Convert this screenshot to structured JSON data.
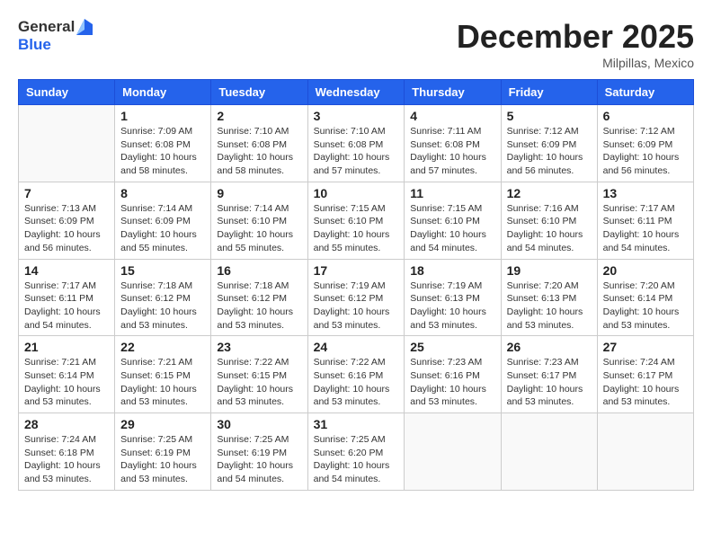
{
  "header": {
    "logo_line1": "General",
    "logo_line2": "Blue",
    "month": "December 2025",
    "location": "Milpillas, Mexico"
  },
  "weekdays": [
    "Sunday",
    "Monday",
    "Tuesday",
    "Wednesday",
    "Thursday",
    "Friday",
    "Saturday"
  ],
  "weeks": [
    [
      {
        "day": "",
        "info": ""
      },
      {
        "day": "1",
        "info": "Sunrise: 7:09 AM\nSunset: 6:08 PM\nDaylight: 10 hours\nand 58 minutes."
      },
      {
        "day": "2",
        "info": "Sunrise: 7:10 AM\nSunset: 6:08 PM\nDaylight: 10 hours\nand 58 minutes."
      },
      {
        "day": "3",
        "info": "Sunrise: 7:10 AM\nSunset: 6:08 PM\nDaylight: 10 hours\nand 57 minutes."
      },
      {
        "day": "4",
        "info": "Sunrise: 7:11 AM\nSunset: 6:08 PM\nDaylight: 10 hours\nand 57 minutes."
      },
      {
        "day": "5",
        "info": "Sunrise: 7:12 AM\nSunset: 6:09 PM\nDaylight: 10 hours\nand 56 minutes."
      },
      {
        "day": "6",
        "info": "Sunrise: 7:12 AM\nSunset: 6:09 PM\nDaylight: 10 hours\nand 56 minutes."
      }
    ],
    [
      {
        "day": "7",
        "info": "Sunrise: 7:13 AM\nSunset: 6:09 PM\nDaylight: 10 hours\nand 56 minutes."
      },
      {
        "day": "8",
        "info": "Sunrise: 7:14 AM\nSunset: 6:09 PM\nDaylight: 10 hours\nand 55 minutes."
      },
      {
        "day": "9",
        "info": "Sunrise: 7:14 AM\nSunset: 6:10 PM\nDaylight: 10 hours\nand 55 minutes."
      },
      {
        "day": "10",
        "info": "Sunrise: 7:15 AM\nSunset: 6:10 PM\nDaylight: 10 hours\nand 55 minutes."
      },
      {
        "day": "11",
        "info": "Sunrise: 7:15 AM\nSunset: 6:10 PM\nDaylight: 10 hours\nand 54 minutes."
      },
      {
        "day": "12",
        "info": "Sunrise: 7:16 AM\nSunset: 6:10 PM\nDaylight: 10 hours\nand 54 minutes."
      },
      {
        "day": "13",
        "info": "Sunrise: 7:17 AM\nSunset: 6:11 PM\nDaylight: 10 hours\nand 54 minutes."
      }
    ],
    [
      {
        "day": "14",
        "info": "Sunrise: 7:17 AM\nSunset: 6:11 PM\nDaylight: 10 hours\nand 54 minutes."
      },
      {
        "day": "15",
        "info": "Sunrise: 7:18 AM\nSunset: 6:12 PM\nDaylight: 10 hours\nand 53 minutes."
      },
      {
        "day": "16",
        "info": "Sunrise: 7:18 AM\nSunset: 6:12 PM\nDaylight: 10 hours\nand 53 minutes."
      },
      {
        "day": "17",
        "info": "Sunrise: 7:19 AM\nSunset: 6:12 PM\nDaylight: 10 hours\nand 53 minutes."
      },
      {
        "day": "18",
        "info": "Sunrise: 7:19 AM\nSunset: 6:13 PM\nDaylight: 10 hours\nand 53 minutes."
      },
      {
        "day": "19",
        "info": "Sunrise: 7:20 AM\nSunset: 6:13 PM\nDaylight: 10 hours\nand 53 minutes."
      },
      {
        "day": "20",
        "info": "Sunrise: 7:20 AM\nSunset: 6:14 PM\nDaylight: 10 hours\nand 53 minutes."
      }
    ],
    [
      {
        "day": "21",
        "info": "Sunrise: 7:21 AM\nSunset: 6:14 PM\nDaylight: 10 hours\nand 53 minutes."
      },
      {
        "day": "22",
        "info": "Sunrise: 7:21 AM\nSunset: 6:15 PM\nDaylight: 10 hours\nand 53 minutes."
      },
      {
        "day": "23",
        "info": "Sunrise: 7:22 AM\nSunset: 6:15 PM\nDaylight: 10 hours\nand 53 minutes."
      },
      {
        "day": "24",
        "info": "Sunrise: 7:22 AM\nSunset: 6:16 PM\nDaylight: 10 hours\nand 53 minutes."
      },
      {
        "day": "25",
        "info": "Sunrise: 7:23 AM\nSunset: 6:16 PM\nDaylight: 10 hours\nand 53 minutes."
      },
      {
        "day": "26",
        "info": "Sunrise: 7:23 AM\nSunset: 6:17 PM\nDaylight: 10 hours\nand 53 minutes."
      },
      {
        "day": "27",
        "info": "Sunrise: 7:24 AM\nSunset: 6:17 PM\nDaylight: 10 hours\nand 53 minutes."
      }
    ],
    [
      {
        "day": "28",
        "info": "Sunrise: 7:24 AM\nSunset: 6:18 PM\nDaylight: 10 hours\nand 53 minutes."
      },
      {
        "day": "29",
        "info": "Sunrise: 7:25 AM\nSunset: 6:19 PM\nDaylight: 10 hours\nand 53 minutes."
      },
      {
        "day": "30",
        "info": "Sunrise: 7:25 AM\nSunset: 6:19 PM\nDaylight: 10 hours\nand 54 minutes."
      },
      {
        "day": "31",
        "info": "Sunrise: 7:25 AM\nSunset: 6:20 PM\nDaylight: 10 hours\nand 54 minutes."
      },
      {
        "day": "",
        "info": ""
      },
      {
        "day": "",
        "info": ""
      },
      {
        "day": "",
        "info": ""
      }
    ]
  ]
}
